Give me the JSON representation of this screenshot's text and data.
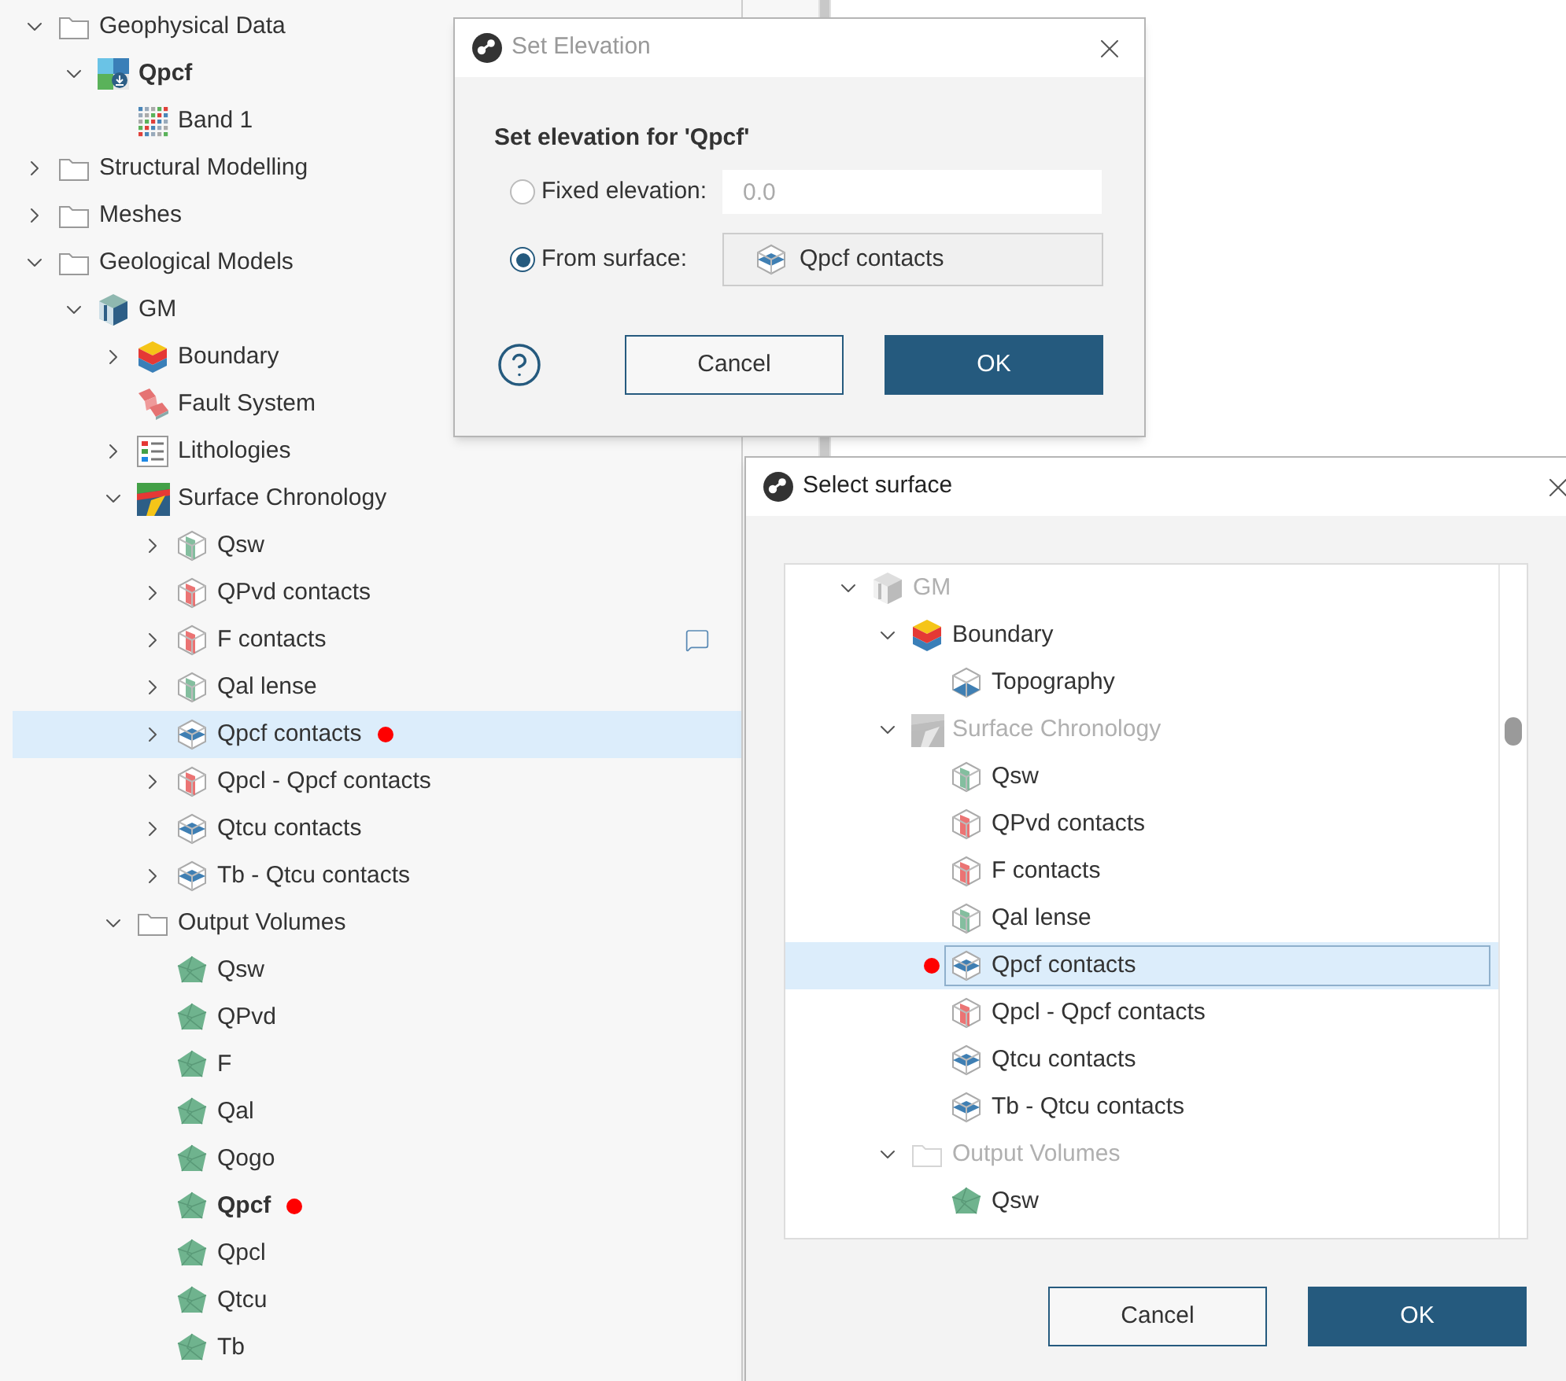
{
  "explorer": {
    "items": [
      {
        "label": "Geophysical Data",
        "kind": "folder",
        "expanded": true,
        "selected": false,
        "bold": false,
        "flagged": false,
        "children": [
          {
            "label": "Qpcf",
            "kind": "raster",
            "expanded": true,
            "selected": false,
            "bold": true,
            "flagged": false,
            "children": [
              {
                "label": "Band 1",
                "kind": "band",
                "selected": false,
                "bold": false,
                "flagged": false
              }
            ]
          }
        ]
      },
      {
        "label": "Structural Modelling",
        "kind": "folder",
        "expanded": false,
        "selected": false,
        "bold": false,
        "flagged": false
      },
      {
        "label": "Meshes",
        "kind": "folder",
        "expanded": false,
        "selected": false,
        "bold": false,
        "flagged": false
      },
      {
        "label": "Geological Models",
        "kind": "folder",
        "expanded": true,
        "selected": false,
        "bold": false,
        "flagged": false,
        "children": [
          {
            "label": "GM",
            "kind": "model",
            "expanded": true,
            "selected": false,
            "bold": false,
            "flagged": false,
            "children": [
              {
                "label": "Boundary",
                "kind": "boundary",
                "expanded": false,
                "selected": false,
                "bold": false,
                "flagged": false
              },
              {
                "label": "Fault System",
                "kind": "fault",
                "selected": false,
                "bold": false,
                "flagged": false
              },
              {
                "label": "Lithologies",
                "kind": "lithology",
                "expanded": false,
                "selected": false,
                "bold": false,
                "flagged": false
              },
              {
                "label": "Surface Chronology",
                "kind": "chronology",
                "expanded": true,
                "selected": false,
                "bold": false,
                "flagged": false,
                "children": [
                  {
                    "label": "Qsw",
                    "kind": "surface-green",
                    "expanded": false,
                    "selected": false,
                    "bold": false,
                    "flagged": false
                  },
                  {
                    "label": "QPvd contacts",
                    "kind": "surface-red",
                    "expanded": false,
                    "selected": false,
                    "bold": false,
                    "flagged": false
                  },
                  {
                    "label": "F contacts",
                    "kind": "surface-red",
                    "expanded": false,
                    "selected": false,
                    "bold": false,
                    "flagged": false,
                    "comment": true
                  },
                  {
                    "label": "Qal lense",
                    "kind": "surface-green",
                    "expanded": false,
                    "selected": false,
                    "bold": false,
                    "flagged": false
                  },
                  {
                    "label": "Qpcf contacts",
                    "kind": "surface-blue",
                    "expanded": false,
                    "selected": true,
                    "bold": false,
                    "flagged": true
                  },
                  {
                    "label": "Qpcl - Qpcf contacts",
                    "kind": "surface-red",
                    "expanded": false,
                    "selected": false,
                    "bold": false,
                    "flagged": false
                  },
                  {
                    "label": "Qtcu contacts",
                    "kind": "surface-blue",
                    "expanded": false,
                    "selected": false,
                    "bold": false,
                    "flagged": false
                  },
                  {
                    "label": "Tb - Qtcu contacts",
                    "kind": "surface-blue",
                    "expanded": false,
                    "selected": false,
                    "bold": false,
                    "flagged": false
                  }
                ]
              },
              {
                "label": "Output Volumes",
                "kind": "folder",
                "expanded": true,
                "selected": false,
                "bold": false,
                "flagged": false,
                "children": [
                  {
                    "label": "Qsw",
                    "kind": "volume",
                    "selected": false,
                    "bold": false,
                    "flagged": false
                  },
                  {
                    "label": "QPvd",
                    "kind": "volume",
                    "selected": false,
                    "bold": false,
                    "flagged": false
                  },
                  {
                    "label": "F",
                    "kind": "volume",
                    "selected": false,
                    "bold": false,
                    "flagged": false
                  },
                  {
                    "label": "Qal",
                    "kind": "volume",
                    "selected": false,
                    "bold": false,
                    "flagged": false
                  },
                  {
                    "label": "Qogo",
                    "kind": "volume",
                    "selected": false,
                    "bold": false,
                    "flagged": false
                  },
                  {
                    "label": "Qpcf",
                    "kind": "volume",
                    "selected": false,
                    "bold": true,
                    "flagged": true
                  },
                  {
                    "label": "Qpcl",
                    "kind": "volume",
                    "selected": false,
                    "bold": false,
                    "flagged": false
                  },
                  {
                    "label": "Qtcu",
                    "kind": "volume",
                    "selected": false,
                    "bold": false,
                    "flagged": false
                  },
                  {
                    "label": "Tb",
                    "kind": "volume",
                    "selected": false,
                    "bold": false,
                    "flagged": false
                  }
                ]
              }
            ]
          }
        ]
      }
    ]
  },
  "set_elevation_dialog": {
    "title": "Set Elevation",
    "active": false,
    "heading": "Set elevation for 'Qpcf'",
    "options": [
      {
        "label": "Fixed elevation:",
        "kind": "field",
        "selected": false,
        "value": "0.0",
        "disabled": true
      },
      {
        "label": "From surface:",
        "kind": "surface",
        "selected": true,
        "value": "Qpcf contacts"
      }
    ],
    "buttons": [
      {
        "label": "Cancel",
        "kind": "secondary"
      },
      {
        "label": "OK",
        "kind": "primary"
      }
    ]
  },
  "select_surface_dialog": {
    "title": "Select surface",
    "active": true,
    "items": [
      {
        "label": "GM",
        "kind": "model",
        "expanded": true,
        "selected": false,
        "disabled": true,
        "flagged": false,
        "children": [
          {
            "label": "Boundary",
            "kind": "boundary",
            "expanded": true,
            "selected": false,
            "disabled": false,
            "flagged": false,
            "children": [
              {
                "label": "Topography",
                "kind": "topography",
                "selected": false,
                "disabled": false,
                "flagged": false
              }
            ]
          },
          {
            "label": "Surface Chronology",
            "kind": "chronology",
            "expanded": true,
            "selected": false,
            "disabled": true,
            "flagged": false,
            "children": [
              {
                "label": "Qsw",
                "kind": "surface-green",
                "selected": false,
                "disabled": false,
                "flagged": false
              },
              {
                "label": "QPvd contacts",
                "kind": "surface-red",
                "selected": false,
                "disabled": false,
                "flagged": false
              },
              {
                "label": "F contacts",
                "kind": "surface-red",
                "selected": false,
                "disabled": false,
                "flagged": false
              },
              {
                "label": "Qal lense",
                "kind": "surface-green",
                "selected": false,
                "disabled": false,
                "flagged": false
              },
              {
                "label": "Qpcf contacts",
                "kind": "surface-blue",
                "selected": true,
                "disabled": false,
                "flagged": true
              },
              {
                "label": "Qpcl - Qpcf contacts",
                "kind": "surface-red",
                "selected": false,
                "disabled": false,
                "flagged": false
              },
              {
                "label": "Qtcu contacts",
                "kind": "surface-blue",
                "selected": false,
                "disabled": false,
                "flagged": false
              },
              {
                "label": "Tb - Qtcu contacts",
                "kind": "surface-blue",
                "selected": false,
                "disabled": false,
                "flagged": false
              }
            ]
          },
          {
            "label": "Output Volumes",
            "kind": "folder",
            "expanded": true,
            "selected": false,
            "disabled": true,
            "flagged": false,
            "children": [
              {
                "label": "Qsw",
                "kind": "volume",
                "selected": false,
                "disabled": false,
                "flagged": false
              }
            ]
          }
        ]
      }
    ],
    "buttons": [
      {
        "label": "Cancel",
        "kind": "secondary"
      },
      {
        "label": "OK",
        "kind": "primary"
      }
    ]
  }
}
